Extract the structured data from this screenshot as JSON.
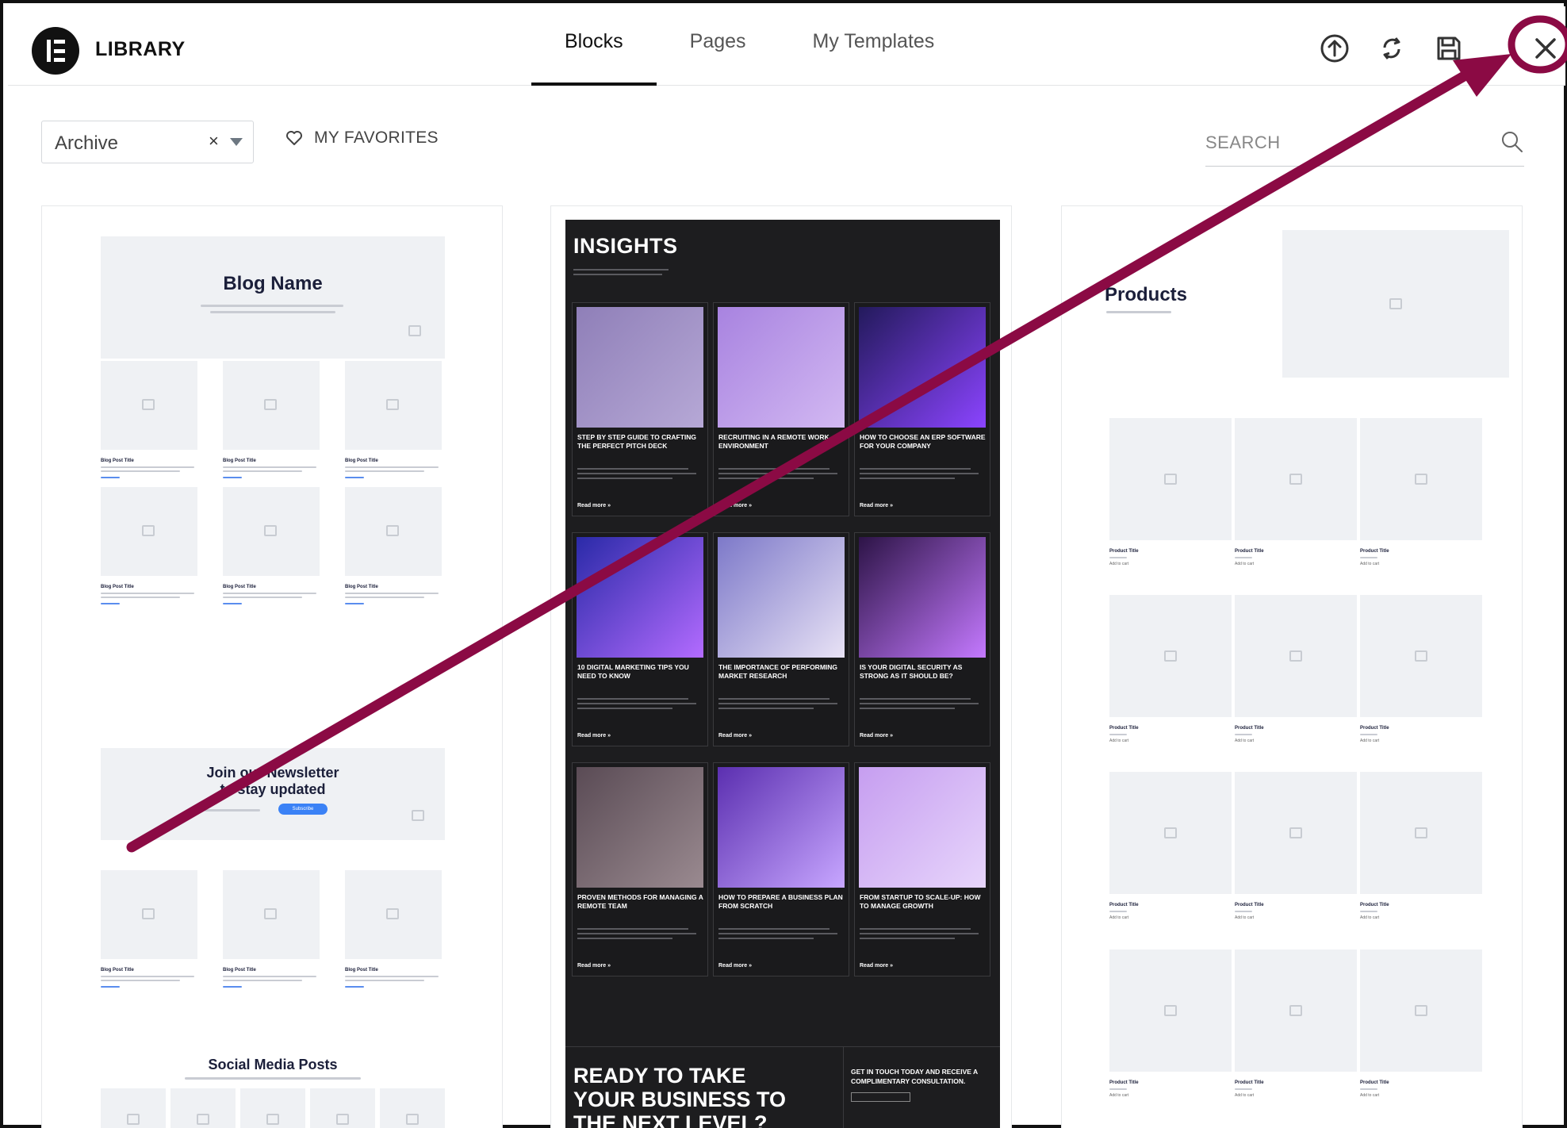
{
  "header": {
    "title": "LIBRARY",
    "tabs": [
      {
        "label": "Blocks",
        "active": true
      },
      {
        "label": "Pages",
        "active": false
      },
      {
        "label": "My Templates",
        "active": false
      }
    ],
    "icons": [
      "upload-icon",
      "sync-icon",
      "save-icon",
      "close-icon"
    ]
  },
  "toolbar": {
    "filter_value": "Archive",
    "clear_glyph": "×",
    "favorites_label": "MY FAVORITES",
    "search_placeholder": "SEARCH"
  },
  "cards": {
    "blog": {
      "title": "Blog Name",
      "newsletter_title": "Join our Newsletter\nto stay updated",
      "subscribe_label": "Subscribe",
      "social_title": "Social Media Posts",
      "post_title": "Blog Post Title",
      "read_more": "Read More"
    },
    "insights": {
      "title": "INSIGHTS",
      "articles": [
        "STEP BY STEP GUIDE TO CRAFTING THE PERFECT PITCH DECK",
        "RECRUITING IN A REMOTE WORK ENVIRONMENT",
        "HOW TO CHOOSE AN ERP SOFTWARE FOR YOUR COMPANY",
        "10 DIGITAL MARKETING TIPS YOU NEED TO KNOW",
        "THE IMPORTANCE OF PERFORMING MARKET RESEARCH",
        "IS YOUR DIGITAL SECURITY AS STRONG AS IT SHOULD BE?",
        "PROVEN METHODS FOR MANAGING A REMOTE TEAM",
        "HOW TO PREPARE A BUSINESS PLAN FROM SCRATCH",
        "FROM STARTUP TO SCALE-UP: HOW TO MANAGE GROWTH"
      ],
      "read_more": "Read more »",
      "cta_heading": "READY TO TAKE\nYOUR BUSINESS TO\nTHE NEXT LEVEL?",
      "cta_text": "GET IN TOUCH TODAY AND RECEIVE A COMPLIMENTARY CONSULTATION."
    },
    "products": {
      "title": "Products",
      "product_title": "Product Title",
      "add_to_cart": "Add to cart"
    }
  },
  "colors": {
    "annotation": "#8b0a44",
    "placeholder": "#eff1f4",
    "dark_card": "#1d1d1f",
    "link_blue": "#5a8dee"
  }
}
